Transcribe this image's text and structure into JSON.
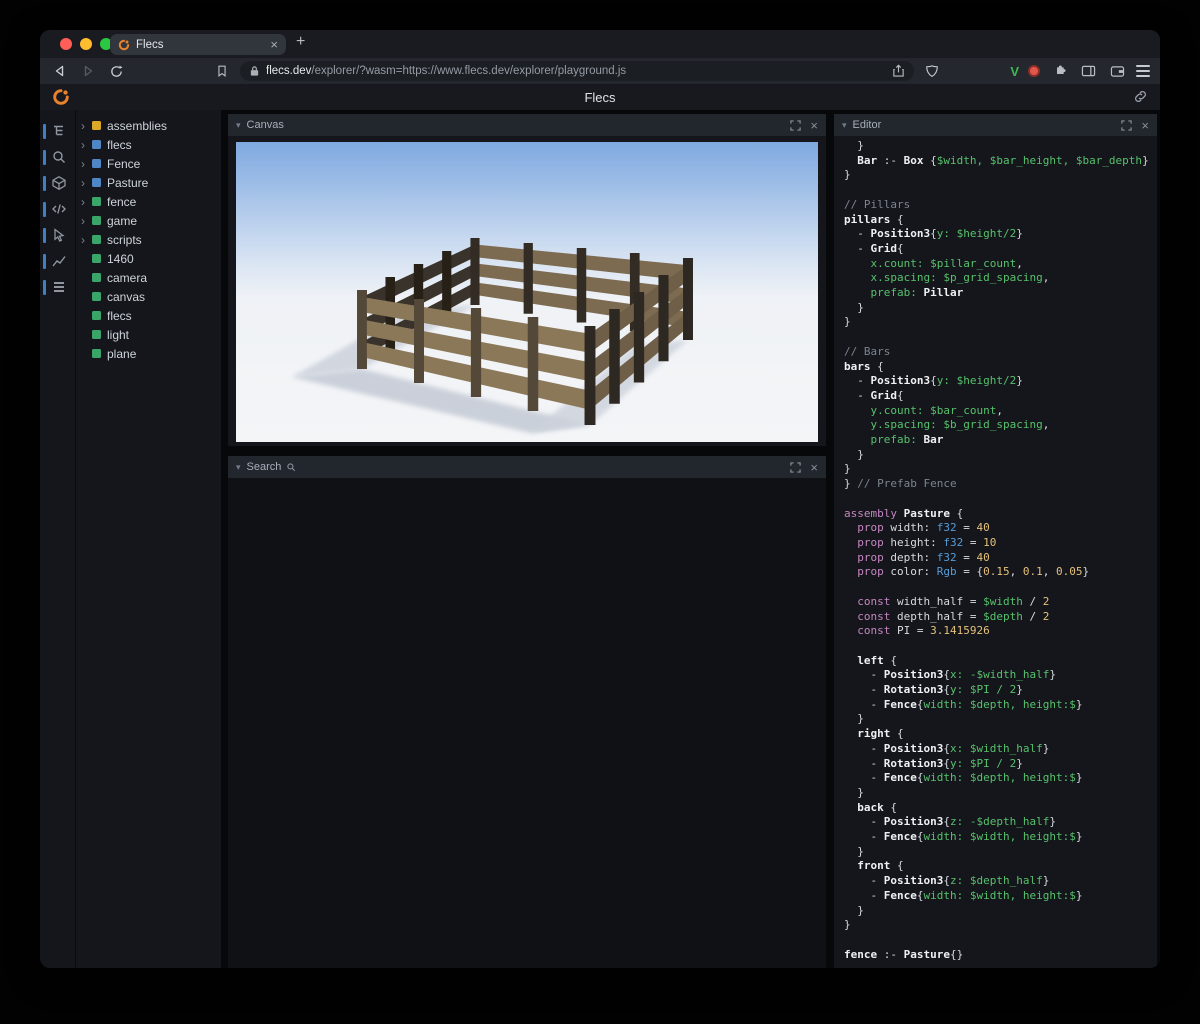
{
  "glyphs": {
    "close": "×",
    "plus": "+",
    "chevron_down": "▾",
    "chevron_right": "›"
  },
  "browser": {
    "tab_title": "Flecs",
    "url_host": "flecs.dev",
    "url_rest": "/explorer/?wasm=https://www.flecs.dev/explorer/playground.js"
  },
  "header": {
    "title": "Flecs"
  },
  "sidebar_icons": [
    "tree",
    "search",
    "entities-cube",
    "code",
    "inspect",
    "chart",
    "rows"
  ],
  "tree": {
    "items": [
      {
        "label": "assemblies",
        "color": "#d9a927",
        "expandable": true
      },
      {
        "label": "flecs",
        "color": "#4e86c6",
        "expandable": true
      },
      {
        "label": "Fence",
        "color": "#4e86c6",
        "expandable": true
      },
      {
        "label": "Pasture",
        "color": "#4e86c6",
        "expandable": true
      },
      {
        "label": "fence",
        "color": "#3aa569",
        "expandable": true
      },
      {
        "label": "game",
        "color": "#3aa569",
        "expandable": true
      },
      {
        "label": "scripts",
        "color": "#3aa569",
        "expandable": true
      },
      {
        "label": "1460",
        "color": "#3aa569",
        "expandable": false
      },
      {
        "label": "camera",
        "color": "#3aa569",
        "expandable": false
      },
      {
        "label": "canvas",
        "color": "#3aa569",
        "expandable": false
      },
      {
        "label": "flecs",
        "color": "#3aa569",
        "expandable": false
      },
      {
        "label": "light",
        "color": "#3aa569",
        "expandable": false
      },
      {
        "label": "plane",
        "color": "#3aa569",
        "expandable": false
      }
    ]
  },
  "panels": {
    "canvas": {
      "title": "Canvas"
    },
    "search": {
      "title": "Search"
    },
    "editor": {
      "title": "Editor"
    }
  },
  "editor": {
    "lines": [
      [
        [
          "  }",
          "p"
        ]
      ],
      [
        [
          "  ",
          "p"
        ],
        [
          "Bar",
          "b"
        ],
        [
          " :- ",
          "p"
        ],
        [
          "Box",
          "b"
        ],
        [
          " {",
          "p"
        ],
        [
          "$width, $bar_height, $bar_depth",
          "v"
        ],
        [
          "}",
          "p"
        ]
      ],
      [
        [
          "}",
          "p"
        ]
      ],
      [],
      [
        [
          "// Pillars",
          "c"
        ]
      ],
      [
        [
          "pillars",
          "b"
        ],
        [
          " {",
          "p"
        ]
      ],
      [
        [
          "  - ",
          "p"
        ],
        [
          "Position3",
          "b"
        ],
        [
          "{",
          "p"
        ],
        [
          "y: $height/2",
          "v"
        ],
        [
          "}",
          "p"
        ]
      ],
      [
        [
          "  - ",
          "p"
        ],
        [
          "Grid",
          "b"
        ],
        [
          "{",
          "p"
        ]
      ],
      [
        [
          "    ",
          "p"
        ],
        [
          "x.count: $pillar_count",
          "v"
        ],
        [
          ",",
          "p"
        ]
      ],
      [
        [
          "    ",
          "p"
        ],
        [
          "x.spacing: $p_grid_spacing",
          "v"
        ],
        [
          ",",
          "p"
        ]
      ],
      [
        [
          "    ",
          "p"
        ],
        [
          "prefab: ",
          "v"
        ],
        [
          "Pillar",
          "b"
        ]
      ],
      [
        [
          "  }",
          "p"
        ]
      ],
      [
        [
          "}",
          "p"
        ]
      ],
      [],
      [
        [
          "// Bars",
          "c"
        ]
      ],
      [
        [
          "bars",
          "b"
        ],
        [
          " {",
          "p"
        ]
      ],
      [
        [
          "  - ",
          "p"
        ],
        [
          "Position3",
          "b"
        ],
        [
          "{",
          "p"
        ],
        [
          "y: $height/2",
          "v"
        ],
        [
          "}",
          "p"
        ]
      ],
      [
        [
          "  - ",
          "p"
        ],
        [
          "Grid",
          "b"
        ],
        [
          "{",
          "p"
        ]
      ],
      [
        [
          "    ",
          "p"
        ],
        [
          "y.count: $bar_count",
          "v"
        ],
        [
          ",",
          "p"
        ]
      ],
      [
        [
          "    ",
          "p"
        ],
        [
          "y.spacing: $b_grid_spacing",
          "v"
        ],
        [
          ",",
          "p"
        ]
      ],
      [
        [
          "    ",
          "p"
        ],
        [
          "prefab: ",
          "v"
        ],
        [
          "Bar",
          "b"
        ]
      ],
      [
        [
          "  }",
          "p"
        ]
      ],
      [
        [
          "}",
          "p"
        ]
      ],
      [
        [
          "} ",
          "p"
        ],
        [
          "// Prefab Fence",
          "c"
        ]
      ],
      [],
      [
        [
          "assembly ",
          "k"
        ],
        [
          "Pasture",
          "b"
        ],
        [
          " {",
          "p"
        ]
      ],
      [
        [
          "  ",
          "p"
        ],
        [
          "prop ",
          "k"
        ],
        [
          "width: ",
          "p"
        ],
        [
          "f32",
          "t"
        ],
        [
          " = ",
          "p"
        ],
        [
          "40",
          "n"
        ]
      ],
      [
        [
          "  ",
          "p"
        ],
        [
          "prop ",
          "k"
        ],
        [
          "height: ",
          "p"
        ],
        [
          "f32",
          "t"
        ],
        [
          " = ",
          "p"
        ],
        [
          "10",
          "n"
        ]
      ],
      [
        [
          "  ",
          "p"
        ],
        [
          "prop ",
          "k"
        ],
        [
          "depth: ",
          "p"
        ],
        [
          "f32",
          "t"
        ],
        [
          " = ",
          "p"
        ],
        [
          "40",
          "n"
        ]
      ],
      [
        [
          "  ",
          "p"
        ],
        [
          "prop ",
          "k"
        ],
        [
          "color: ",
          "p"
        ],
        [
          "Rgb",
          "t"
        ],
        [
          " = {",
          "p"
        ],
        [
          "0.15",
          "n"
        ],
        [
          ", ",
          "p"
        ],
        [
          "0.1",
          "n"
        ],
        [
          ", ",
          "p"
        ],
        [
          "0.05",
          "n"
        ],
        [
          "}",
          "p"
        ]
      ],
      [],
      [
        [
          "  ",
          "p"
        ],
        [
          "const ",
          "k"
        ],
        [
          "width_half",
          "p"
        ],
        [
          " = ",
          "p"
        ],
        [
          "$width",
          "v"
        ],
        [
          " / ",
          "p"
        ],
        [
          "2",
          "n"
        ]
      ],
      [
        [
          "  ",
          "p"
        ],
        [
          "const ",
          "k"
        ],
        [
          "depth_half",
          "p"
        ],
        [
          " = ",
          "p"
        ],
        [
          "$depth",
          "v"
        ],
        [
          " / ",
          "p"
        ],
        [
          "2",
          "n"
        ]
      ],
      [
        [
          "  ",
          "p"
        ],
        [
          "const ",
          "k"
        ],
        [
          "PI",
          "p"
        ],
        [
          " = ",
          "p"
        ],
        [
          "3.1415926",
          "n"
        ]
      ],
      [],
      [
        [
          "  ",
          "p"
        ],
        [
          "left",
          "b"
        ],
        [
          " {",
          "p"
        ]
      ],
      [
        [
          "    - ",
          "p"
        ],
        [
          "Position3",
          "b"
        ],
        [
          "{",
          "p"
        ],
        [
          "x: -$width_half",
          "v"
        ],
        [
          "}",
          "p"
        ]
      ],
      [
        [
          "    - ",
          "p"
        ],
        [
          "Rotation3",
          "b"
        ],
        [
          "{",
          "p"
        ],
        [
          "y: $PI / 2",
          "v"
        ],
        [
          "}",
          "p"
        ]
      ],
      [
        [
          "    - ",
          "p"
        ],
        [
          "Fence",
          "b"
        ],
        [
          "{",
          "p"
        ],
        [
          "width: $depth, height:$",
          "v"
        ],
        [
          "}",
          "p"
        ]
      ],
      [
        [
          "  }",
          "p"
        ]
      ],
      [
        [
          "  ",
          "p"
        ],
        [
          "right",
          "b"
        ],
        [
          " {",
          "p"
        ]
      ],
      [
        [
          "    - ",
          "p"
        ],
        [
          "Position3",
          "b"
        ],
        [
          "{",
          "p"
        ],
        [
          "x: $width_half",
          "v"
        ],
        [
          "}",
          "p"
        ]
      ],
      [
        [
          "    - ",
          "p"
        ],
        [
          "Rotation3",
          "b"
        ],
        [
          "{",
          "p"
        ],
        [
          "y: $PI / 2",
          "v"
        ],
        [
          "}",
          "p"
        ]
      ],
      [
        [
          "    - ",
          "p"
        ],
        [
          "Fence",
          "b"
        ],
        [
          "{",
          "p"
        ],
        [
          "width: $depth, height:$",
          "v"
        ],
        [
          "}",
          "p"
        ]
      ],
      [
        [
          "  }",
          "p"
        ]
      ],
      [
        [
          "  ",
          "p"
        ],
        [
          "back",
          "b"
        ],
        [
          " {",
          "p"
        ]
      ],
      [
        [
          "    - ",
          "p"
        ],
        [
          "Position3",
          "b"
        ],
        [
          "{",
          "p"
        ],
        [
          "z: -$depth_half",
          "v"
        ],
        [
          "}",
          "p"
        ]
      ],
      [
        [
          "    - ",
          "p"
        ],
        [
          "Fence",
          "b"
        ],
        [
          "{",
          "p"
        ],
        [
          "width: $width, height:$",
          "v"
        ],
        [
          "}",
          "p"
        ]
      ],
      [
        [
          "  }",
          "p"
        ]
      ],
      [
        [
          "  ",
          "p"
        ],
        [
          "front",
          "b"
        ],
        [
          " {",
          "p"
        ]
      ],
      [
        [
          "    - ",
          "p"
        ],
        [
          "Position3",
          "b"
        ],
        [
          "{",
          "p"
        ],
        [
          "z: $depth_half",
          "v"
        ],
        [
          "}",
          "p"
        ]
      ],
      [
        [
          "    - ",
          "p"
        ],
        [
          "Fence",
          "b"
        ],
        [
          "{",
          "p"
        ],
        [
          "width: $width, height:$",
          "v"
        ],
        [
          "}",
          "p"
        ]
      ],
      [
        [
          "  }",
          "p"
        ]
      ],
      [
        [
          "}",
          "p"
        ]
      ],
      [],
      [
        [
          "fence",
          "b"
        ],
        [
          " :- ",
          "p"
        ],
        [
          "Pasture",
          "b"
        ],
        [
          "{}",
          "p"
        ]
      ]
    ]
  }
}
